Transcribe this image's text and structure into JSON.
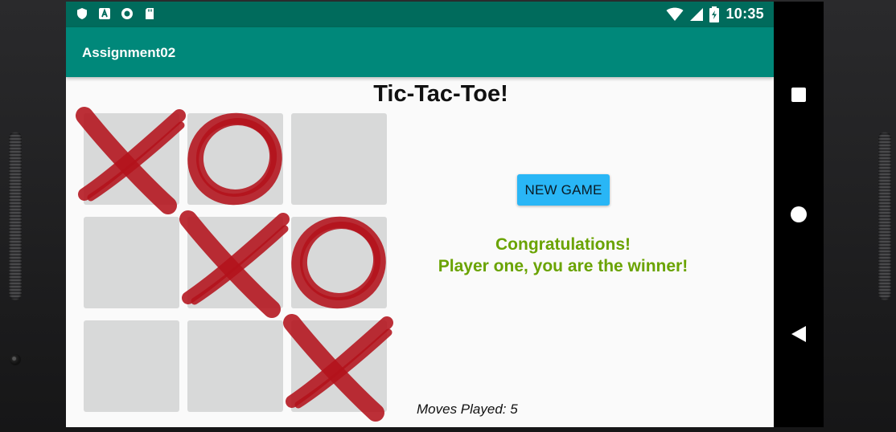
{
  "status_bar": {
    "time": "10:35",
    "icons": [
      "shield-icon",
      "a-icon",
      "circle-icon",
      "sd-card-icon",
      "wifi-icon",
      "signal-icon",
      "battery-charging-icon"
    ]
  },
  "app_bar": {
    "title": "Assignment02"
  },
  "game": {
    "title": "Tic-Tac-Toe!",
    "board": [
      [
        "X",
        "O",
        ""
      ],
      [
        "",
        "X",
        "O"
      ],
      [
        "",
        "",
        "X"
      ]
    ],
    "new_game_label": "NEW GAME",
    "winner_line1": "Congratulations!",
    "winner_line2": "Player one, you are the winner!",
    "moves_played": "Moves Played: 5"
  },
  "colors": {
    "status_bar": "#006b5c",
    "app_bar": "#00887a",
    "mark_red": "#b3121b",
    "cell_gray": "#d8d9d9",
    "button_blue": "#29b6f6",
    "winner_green": "#6aa300"
  },
  "nav_bar": {
    "buttons": [
      "recents-square-icon",
      "home-circle-icon",
      "back-triangle-icon"
    ]
  }
}
